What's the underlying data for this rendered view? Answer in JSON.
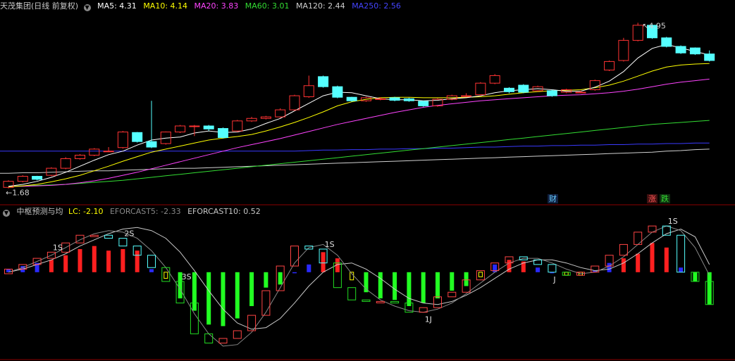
{
  "price_panel": {
    "title": "天茂集团(日线 前复权)",
    "indicators": [
      {
        "label": "MA5: 4.31",
        "color": "#ffffff"
      },
      {
        "label": "MA10: 4.14",
        "color": "#ffff00"
      },
      {
        "label": "MA20: 3.83",
        "color": "#ff44ff"
      },
      {
        "label": "MA60: 3.01",
        "color": "#33dd33"
      },
      {
        "label": "MA120: 2.44",
        "color": "#cfcfcf"
      },
      {
        "label": "MA250: 2.56",
        "color": "#4444ff"
      }
    ],
    "high_label": "4.95",
    "low_label": "1.68",
    "badges": {
      "cai": "财",
      "zhang": "涨",
      "die": "跌"
    }
  },
  "indicator_panel": {
    "title": "中枢预测与均",
    "items": [
      {
        "label": "LC: -2.10",
        "color": "#ffff00"
      },
      {
        "label": "EFORCAST5: -2.33",
        "color": "#888888"
      },
      {
        "label": "EFORCAST10: 0.52",
        "color": "#c8c8c8"
      }
    ],
    "markers": [
      {
        "text": "1S",
        "i": 3
      },
      {
        "text": "2S",
        "i": 8
      },
      {
        "text": "3S",
        "i": 12
      },
      {
        "text": "1S",
        "i": 22
      },
      {
        "text": "1J",
        "i": 29
      },
      {
        "text": "J",
        "i": 38
      },
      {
        "text": "1S",
        "i": 46
      }
    ]
  },
  "colors": {
    "up": "#ff3333",
    "down": "#55ffff",
    "background": "#000000",
    "separator": "#8b0000"
  },
  "chart_data": [
    {
      "type": "candlestick",
      "title": "天茂集团(日线 前复权)",
      "x": [
        0,
        1,
        2,
        3,
        4,
        5,
        6,
        7,
        8,
        9,
        10,
        11,
        12,
        13,
        14,
        15,
        16,
        17,
        18,
        19,
        20,
        21,
        22,
        23,
        24,
        25,
        26,
        27,
        28,
        29,
        30,
        31,
        32,
        33,
        34,
        35,
        36,
        37,
        38,
        39,
        40,
        41,
        42,
        43,
        44,
        45,
        46,
        47,
        48,
        49
      ],
      "open": [
        1.68,
        1.8,
        1.9,
        1.92,
        2.06,
        2.25,
        2.32,
        2.4,
        2.47,
        2.77,
        2.59,
        2.55,
        2.78,
        2.9,
        2.9,
        2.85,
        2.8,
        3.0,
        3.05,
        3.08,
        3.22,
        3.48,
        3.88,
        3.68,
        3.47,
        3.4,
        3.43,
        3.46,
        3.44,
        3.39,
        3.3,
        3.43,
        3.5,
        3.52,
        3.75,
        3.65,
        3.71,
        3.6,
        3.6,
        3.57,
        3.57,
        3.62,
        4.01,
        4.2,
        4.6,
        4.9,
        4.65,
        4.48,
        4.45,
        4.33
      ],
      "close": [
        1.8,
        1.9,
        1.84,
        2.06,
        2.25,
        2.32,
        2.44,
        2.4,
        2.78,
        2.59,
        2.48,
        2.78,
        2.9,
        2.9,
        2.84,
        2.67,
        3.0,
        3.05,
        3.08,
        3.22,
        3.5,
        3.7,
        3.68,
        3.47,
        3.4,
        3.46,
        3.44,
        3.41,
        3.4,
        3.3,
        3.43,
        3.5,
        3.5,
        3.75,
        3.9,
        3.58,
        3.57,
        3.68,
        3.5,
        3.62,
        3.57,
        3.8,
        4.18,
        4.6,
        4.9,
        4.65,
        4.48,
        4.35,
        4.33,
        4.2
      ],
      "high": [
        1.82,
        1.92,
        1.91,
        2.08,
        2.28,
        2.34,
        2.46,
        2.48,
        2.8,
        2.78,
        3.4,
        2.79,
        2.92,
        2.92,
        2.92,
        2.87,
        3.02,
        3.08,
        3.1,
        3.25,
        3.52,
        3.9,
        3.9,
        3.7,
        3.48,
        3.48,
        3.47,
        3.48,
        3.46,
        3.4,
        3.45,
        3.52,
        3.55,
        3.77,
        3.93,
        3.67,
        3.73,
        3.7,
        3.62,
        3.64,
        3.6,
        3.82,
        4.2,
        4.65,
        4.95,
        4.92,
        4.67,
        4.5,
        4.46,
        4.4
      ],
      "low": [
        1.66,
        1.78,
        1.82,
        1.9,
        2.04,
        2.23,
        2.3,
        2.38,
        2.45,
        2.57,
        2.46,
        2.53,
        2.76,
        2.7,
        2.8,
        2.65,
        2.78,
        2.98,
        3.03,
        3.06,
        3.2,
        3.46,
        3.66,
        3.45,
        3.38,
        3.38,
        3.41,
        3.39,
        3.38,
        3.28,
        3.28,
        3.41,
        3.48,
        3.5,
        3.73,
        3.55,
        3.55,
        3.58,
        3.48,
        3.55,
        3.55,
        3.6,
        3.99,
        4.18,
        4.58,
        4.63,
        4.46,
        4.33,
        4.31,
        4.18
      ],
      "ma5": [
        1.7,
        1.74,
        1.8,
        1.88,
        1.98,
        2.1,
        2.22,
        2.33,
        2.4,
        2.52,
        2.62,
        2.66,
        2.68,
        2.76,
        2.8,
        2.77,
        2.78,
        2.84,
        2.95,
        3.05,
        3.2,
        3.35,
        3.5,
        3.57,
        3.56,
        3.5,
        3.44,
        3.42,
        3.42,
        3.4,
        3.41,
        3.44,
        3.46,
        3.5,
        3.56,
        3.6,
        3.62,
        3.64,
        3.62,
        3.59,
        3.59,
        3.67,
        3.79,
        3.98,
        4.25,
        4.44,
        4.52,
        4.45,
        4.38,
        4.31
      ],
      "ma10": [
        1.69,
        1.71,
        1.74,
        1.79,
        1.85,
        1.92,
        2.01,
        2.1,
        2.2,
        2.29,
        2.38,
        2.44,
        2.5,
        2.56,
        2.62,
        2.66,
        2.69,
        2.73,
        2.8,
        2.88,
        2.97,
        3.07,
        3.18,
        3.3,
        3.38,
        3.43,
        3.46,
        3.47,
        3.47,
        3.46,
        3.46,
        3.46,
        3.47,
        3.48,
        3.5,
        3.53,
        3.56,
        3.58,
        3.6,
        3.61,
        3.62,
        3.66,
        3.71,
        3.79,
        3.89,
        3.99,
        4.07,
        4.11,
        4.13,
        4.14
      ],
      "ma20": [
        1.7,
        1.7,
        1.71,
        1.72,
        1.74,
        1.77,
        1.81,
        1.86,
        1.92,
        1.98,
        2.05,
        2.12,
        2.19,
        2.26,
        2.33,
        2.4,
        2.47,
        2.53,
        2.59,
        2.65,
        2.72,
        2.79,
        2.86,
        2.93,
        2.99,
        3.05,
        3.11,
        3.17,
        3.22,
        3.27,
        3.31,
        3.34,
        3.37,
        3.4,
        3.42,
        3.44,
        3.46,
        3.48,
        3.5,
        3.51,
        3.52,
        3.54,
        3.56,
        3.59,
        3.63,
        3.68,
        3.73,
        3.77,
        3.8,
        3.83
      ],
      "ma60": [
        1.7,
        1.71,
        1.72,
        1.73,
        1.74,
        1.76,
        1.78,
        1.8,
        1.82,
        1.85,
        1.88,
        1.91,
        1.94,
        1.97,
        2.0,
        2.03,
        2.06,
        2.09,
        2.12,
        2.15,
        2.18,
        2.21,
        2.24,
        2.27,
        2.3,
        2.33,
        2.36,
        2.39,
        2.42,
        2.45,
        2.48,
        2.51,
        2.54,
        2.57,
        2.6,
        2.63,
        2.66,
        2.69,
        2.72,
        2.75,
        2.78,
        2.81,
        2.84,
        2.87,
        2.9,
        2.93,
        2.95,
        2.97,
        2.99,
        3.01
      ],
      "ma120": [
        1.96,
        1.97,
        1.97,
        1.98,
        1.99,
        2.0,
        2.01,
        2.01,
        2.02,
        2.03,
        2.04,
        2.05,
        2.06,
        2.06,
        2.07,
        2.08,
        2.09,
        2.1,
        2.11,
        2.12,
        2.13,
        2.14,
        2.15,
        2.16,
        2.17,
        2.18,
        2.19,
        2.2,
        2.21,
        2.22,
        2.23,
        2.24,
        2.25,
        2.26,
        2.27,
        2.28,
        2.29,
        2.3,
        2.31,
        2.32,
        2.33,
        2.34,
        2.35,
        2.36,
        2.37,
        2.38,
        2.4,
        2.41,
        2.43,
        2.44
      ],
      "ma250": [
        2.4,
        2.4,
        2.4,
        2.4,
        2.4,
        2.4,
        2.4,
        2.4,
        2.4,
        2.4,
        2.4,
        2.4,
        2.4,
        2.4,
        2.4,
        2.4,
        2.4,
        2.4,
        2.4,
        2.4,
        2.4,
        2.41,
        2.42,
        2.42,
        2.43,
        2.43,
        2.44,
        2.44,
        2.45,
        2.45,
        2.46,
        2.46,
        2.47,
        2.48,
        2.48,
        2.49,
        2.5,
        2.5,
        2.51,
        2.51,
        2.52,
        2.52,
        2.53,
        2.53,
        2.54,
        2.54,
        2.55,
        2.55,
        2.56,
        2.56
      ],
      "ylim": [
        1.6,
        5.15
      ]
    },
    {
      "type": "bar",
      "title": "中枢预测与均",
      "x": [
        0,
        1,
        2,
        3,
        4,
        5,
        6,
        7,
        8,
        9,
        10,
        11,
        12,
        13,
        14,
        15,
        16,
        17,
        18,
        19,
        20,
        21,
        22,
        23,
        24,
        25,
        26,
        27,
        28,
        29,
        30,
        31,
        32,
        33,
        34,
        35,
        36,
        37,
        38,
        39,
        40,
        41,
        42,
        43,
        44,
        45,
        46,
        47,
        48,
        49
      ],
      "bars": [
        0.2,
        0.4,
        0.6,
        0.8,
        1.1,
        1.5,
        1.7,
        1.4,
        1.5,
        1.4,
        0.2,
        -0.4,
        -1.7,
        -2.5,
        -3.4,
        -3.5,
        -3.0,
        -2.2,
        -1.0,
        -0.8,
        0,
        0.5,
        1.3,
        0.9,
        -0.5,
        -1.3,
        -1.7,
        -1.8,
        -2.2,
        -2.0,
        -1.7,
        -1.2,
        -0.9,
        -0.3,
        0.5,
        0.8,
        0.7,
        0.3,
        0,
        -0.2,
        -0.2,
        0.1,
        0.6,
        0.9,
        1.2,
        1.9,
        1.6,
        0.3,
        -0.6,
        -2.1
      ],
      "lc_box_open": [
        -0.1,
        0.2,
        0.5,
        0.9,
        1.3,
        1.9,
        2.4,
        2.4,
        2.2,
        1.7,
        1.1,
        0.3,
        -0.6,
        -2.0,
        -4.0,
        -4.6,
        -4.3,
        -3.8,
        -2.8,
        -1.2,
        0.4,
        1.7,
        1.5,
        0.6,
        -1.0,
        -1.8,
        -1.9,
        -1.9,
        -2.0,
        -2.6,
        -2.3,
        -1.6,
        -1.3,
        -0.5,
        0.1,
        0.6,
        1.0,
        0.8,
        0.5,
        0.0,
        -0.2,
        0.0,
        0.4,
        1.1,
        1.8,
        2.6,
        3.0,
        2.4,
        0.0,
        -0.6
      ],
      "lc_box_close": [
        0.2,
        0.5,
        0.9,
        1.3,
        1.9,
        2.4,
        2.4,
        2.2,
        1.7,
        1.1,
        0.3,
        -0.6,
        -2.0,
        -4.0,
        -4.6,
        -4.3,
        -3.8,
        -2.8,
        -1.2,
        0.4,
        1.7,
        1.5,
        0.6,
        -1.0,
        -1.8,
        -1.9,
        -1.9,
        -2.0,
        -2.6,
        -2.3,
        -1.6,
        -1.3,
        -0.5,
        0.1,
        0.6,
        1.0,
        0.8,
        0.5,
        0.0,
        -0.2,
        0.0,
        0.4,
        1.1,
        1.8,
        2.6,
        3.0,
        2.4,
        0.0,
        -0.6,
        -2.1
      ],
      "eforcast5": [
        0.0,
        0.3,
        0.7,
        1.1,
        1.6,
        2.1,
        2.5,
        2.7,
        2.6,
        2.2,
        1.4,
        0.3,
        -1.1,
        -2.7,
        -4.0,
        -4.8,
        -4.7,
        -3.9,
        -2.6,
        -1.0,
        0.6,
        1.6,
        1.8,
        1.1,
        -0.1,
        -1.1,
        -1.8,
        -2.2,
        -2.5,
        -2.6,
        -2.4,
        -2.0,
        -1.4,
        -0.7,
        0.0,
        0.6,
        0.9,
        0.9,
        0.6,
        0.2,
        -0.1,
        0.0,
        0.4,
        1.0,
        1.8,
        2.6,
        3.0,
        2.7,
        1.6,
        -0.2
      ],
      "eforcast10": [
        0.0,
        0.2,
        0.5,
        0.8,
        1.2,
        1.7,
        2.1,
        2.5,
        2.8,
        2.9,
        2.7,
        2.2,
        1.3,
        0.1,
        -1.2,
        -2.4,
        -3.3,
        -3.7,
        -3.6,
        -3.0,
        -2.0,
        -0.9,
        0.0,
        0.5,
        0.6,
        0.2,
        -0.4,
        -1.1,
        -1.7,
        -2.0,
        -2.1,
        -1.9,
        -1.5,
        -1.0,
        -0.4,
        0.2,
        0.6,
        0.8,
        0.8,
        0.6,
        0.3,
        0.1,
        0.2,
        0.6,
        1.2,
        1.9,
        2.5,
        2.8,
        2.3,
        0.5
      ],
      "ylim": [
        -5.4,
        3.6
      ]
    }
  ]
}
